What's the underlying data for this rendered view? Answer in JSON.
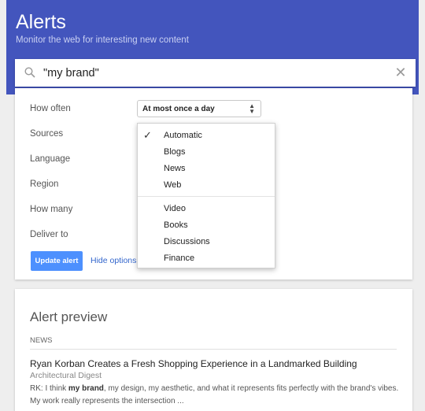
{
  "header": {
    "title": "Alerts",
    "subtitle": "Monitor the web for interesting new content"
  },
  "search": {
    "value": "\"my brand\"",
    "placeholder": ""
  },
  "options": {
    "labels": [
      "How often",
      "Sources",
      "Language",
      "Region",
      "How many",
      "Deliver to"
    ],
    "how_often_value": "At most once a day",
    "update_button": "Update alert",
    "hide_options": "Hide options"
  },
  "sources_dropdown": {
    "selected": "Automatic",
    "items": [
      "Automatic",
      "Blogs",
      "News",
      "Web",
      "Video",
      "Books",
      "Discussions",
      "Finance"
    ]
  },
  "preview": {
    "title": "Alert preview",
    "section": "NEWS",
    "article": {
      "title": "Ryan Korban Creates a Fresh Shopping Experience in a Landmarked Building",
      "source": "Architectural Digest",
      "snippet_prefix": "RK: I think ",
      "snippet_bold": "my brand",
      "snippet_suffix": ", my design, my aesthetic, and what it represents fits perfectly with the brand's vibes. My work really represents the intersection ..."
    }
  },
  "colors": {
    "header_bg": "#4355bd",
    "button_bg": "#4d90fe",
    "link": "#3366cc"
  },
  "icons": {
    "search": "search-icon",
    "clear": "close-icon",
    "check": "check-icon",
    "select_arrows": "sort-arrows-icon"
  }
}
